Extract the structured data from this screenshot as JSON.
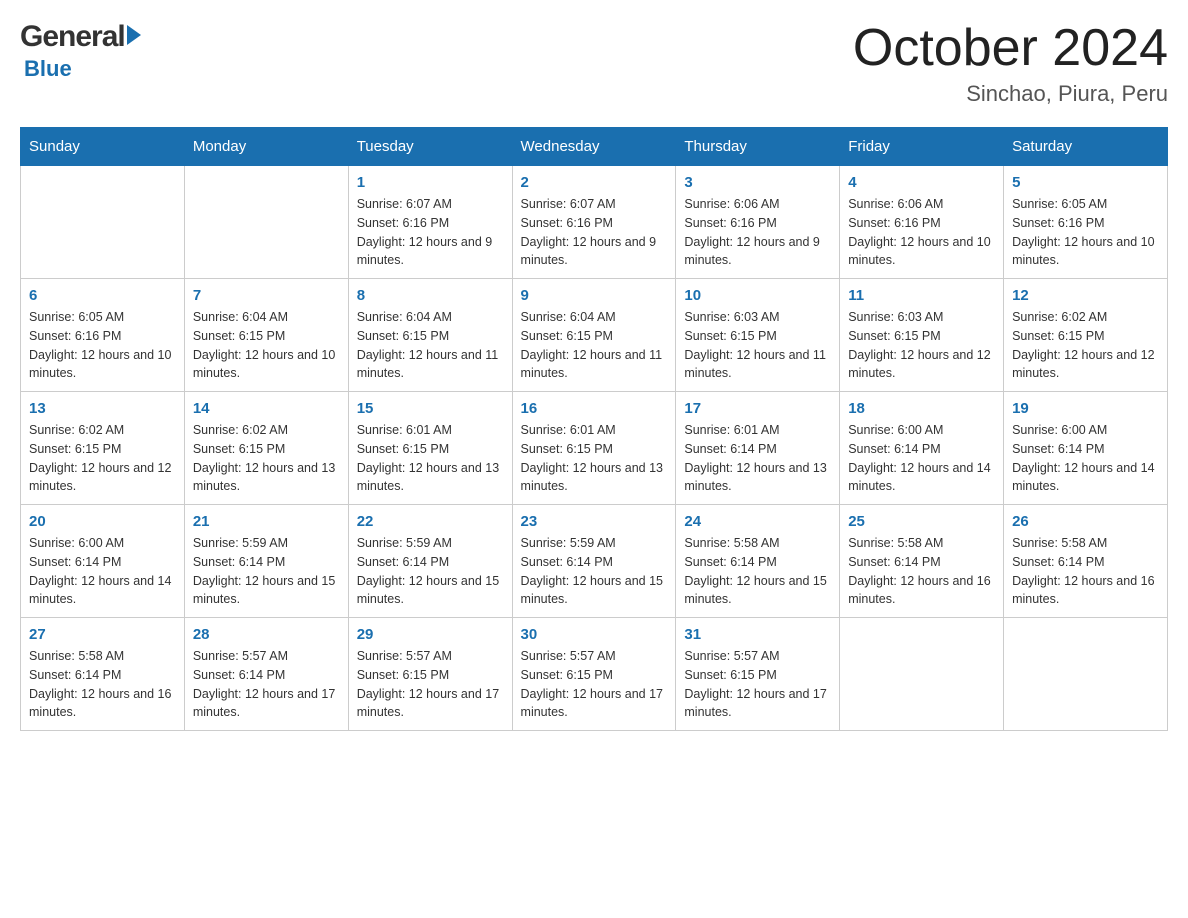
{
  "header": {
    "logo_general": "General",
    "logo_blue": "Blue",
    "month_title": "October 2024",
    "subtitle": "Sinchao, Piura, Peru"
  },
  "days_of_week": [
    "Sunday",
    "Monday",
    "Tuesday",
    "Wednesday",
    "Thursday",
    "Friday",
    "Saturday"
  ],
  "weeks": [
    [
      {
        "day": "",
        "sunrise": "",
        "sunset": "",
        "daylight": ""
      },
      {
        "day": "",
        "sunrise": "",
        "sunset": "",
        "daylight": ""
      },
      {
        "day": "1",
        "sunrise": "Sunrise: 6:07 AM",
        "sunset": "Sunset: 6:16 PM",
        "daylight": "Daylight: 12 hours and 9 minutes."
      },
      {
        "day": "2",
        "sunrise": "Sunrise: 6:07 AM",
        "sunset": "Sunset: 6:16 PM",
        "daylight": "Daylight: 12 hours and 9 minutes."
      },
      {
        "day": "3",
        "sunrise": "Sunrise: 6:06 AM",
        "sunset": "Sunset: 6:16 PM",
        "daylight": "Daylight: 12 hours and 9 minutes."
      },
      {
        "day": "4",
        "sunrise": "Sunrise: 6:06 AM",
        "sunset": "Sunset: 6:16 PM",
        "daylight": "Daylight: 12 hours and 10 minutes."
      },
      {
        "day": "5",
        "sunrise": "Sunrise: 6:05 AM",
        "sunset": "Sunset: 6:16 PM",
        "daylight": "Daylight: 12 hours and 10 minutes."
      }
    ],
    [
      {
        "day": "6",
        "sunrise": "Sunrise: 6:05 AM",
        "sunset": "Sunset: 6:16 PM",
        "daylight": "Daylight: 12 hours and 10 minutes."
      },
      {
        "day": "7",
        "sunrise": "Sunrise: 6:04 AM",
        "sunset": "Sunset: 6:15 PM",
        "daylight": "Daylight: 12 hours and 10 minutes."
      },
      {
        "day": "8",
        "sunrise": "Sunrise: 6:04 AM",
        "sunset": "Sunset: 6:15 PM",
        "daylight": "Daylight: 12 hours and 11 minutes."
      },
      {
        "day": "9",
        "sunrise": "Sunrise: 6:04 AM",
        "sunset": "Sunset: 6:15 PM",
        "daylight": "Daylight: 12 hours and 11 minutes."
      },
      {
        "day": "10",
        "sunrise": "Sunrise: 6:03 AM",
        "sunset": "Sunset: 6:15 PM",
        "daylight": "Daylight: 12 hours and 11 minutes."
      },
      {
        "day": "11",
        "sunrise": "Sunrise: 6:03 AM",
        "sunset": "Sunset: 6:15 PM",
        "daylight": "Daylight: 12 hours and 12 minutes."
      },
      {
        "day": "12",
        "sunrise": "Sunrise: 6:02 AM",
        "sunset": "Sunset: 6:15 PM",
        "daylight": "Daylight: 12 hours and 12 minutes."
      }
    ],
    [
      {
        "day": "13",
        "sunrise": "Sunrise: 6:02 AM",
        "sunset": "Sunset: 6:15 PM",
        "daylight": "Daylight: 12 hours and 12 minutes."
      },
      {
        "day": "14",
        "sunrise": "Sunrise: 6:02 AM",
        "sunset": "Sunset: 6:15 PM",
        "daylight": "Daylight: 12 hours and 13 minutes."
      },
      {
        "day": "15",
        "sunrise": "Sunrise: 6:01 AM",
        "sunset": "Sunset: 6:15 PM",
        "daylight": "Daylight: 12 hours and 13 minutes."
      },
      {
        "day": "16",
        "sunrise": "Sunrise: 6:01 AM",
        "sunset": "Sunset: 6:15 PM",
        "daylight": "Daylight: 12 hours and 13 minutes."
      },
      {
        "day": "17",
        "sunrise": "Sunrise: 6:01 AM",
        "sunset": "Sunset: 6:14 PM",
        "daylight": "Daylight: 12 hours and 13 minutes."
      },
      {
        "day": "18",
        "sunrise": "Sunrise: 6:00 AM",
        "sunset": "Sunset: 6:14 PM",
        "daylight": "Daylight: 12 hours and 14 minutes."
      },
      {
        "day": "19",
        "sunrise": "Sunrise: 6:00 AM",
        "sunset": "Sunset: 6:14 PM",
        "daylight": "Daylight: 12 hours and 14 minutes."
      }
    ],
    [
      {
        "day": "20",
        "sunrise": "Sunrise: 6:00 AM",
        "sunset": "Sunset: 6:14 PM",
        "daylight": "Daylight: 12 hours and 14 minutes."
      },
      {
        "day": "21",
        "sunrise": "Sunrise: 5:59 AM",
        "sunset": "Sunset: 6:14 PM",
        "daylight": "Daylight: 12 hours and 15 minutes."
      },
      {
        "day": "22",
        "sunrise": "Sunrise: 5:59 AM",
        "sunset": "Sunset: 6:14 PM",
        "daylight": "Daylight: 12 hours and 15 minutes."
      },
      {
        "day": "23",
        "sunrise": "Sunrise: 5:59 AM",
        "sunset": "Sunset: 6:14 PM",
        "daylight": "Daylight: 12 hours and 15 minutes."
      },
      {
        "day": "24",
        "sunrise": "Sunrise: 5:58 AM",
        "sunset": "Sunset: 6:14 PM",
        "daylight": "Daylight: 12 hours and 15 minutes."
      },
      {
        "day": "25",
        "sunrise": "Sunrise: 5:58 AM",
        "sunset": "Sunset: 6:14 PM",
        "daylight": "Daylight: 12 hours and 16 minutes."
      },
      {
        "day": "26",
        "sunrise": "Sunrise: 5:58 AM",
        "sunset": "Sunset: 6:14 PM",
        "daylight": "Daylight: 12 hours and 16 minutes."
      }
    ],
    [
      {
        "day": "27",
        "sunrise": "Sunrise: 5:58 AM",
        "sunset": "Sunset: 6:14 PM",
        "daylight": "Daylight: 12 hours and 16 minutes."
      },
      {
        "day": "28",
        "sunrise": "Sunrise: 5:57 AM",
        "sunset": "Sunset: 6:14 PM",
        "daylight": "Daylight: 12 hours and 17 minutes."
      },
      {
        "day": "29",
        "sunrise": "Sunrise: 5:57 AM",
        "sunset": "Sunset: 6:15 PM",
        "daylight": "Daylight: 12 hours and 17 minutes."
      },
      {
        "day": "30",
        "sunrise": "Sunrise: 5:57 AM",
        "sunset": "Sunset: 6:15 PM",
        "daylight": "Daylight: 12 hours and 17 minutes."
      },
      {
        "day": "31",
        "sunrise": "Sunrise: 5:57 AM",
        "sunset": "Sunset: 6:15 PM",
        "daylight": "Daylight: 12 hours and 17 minutes."
      },
      {
        "day": "",
        "sunrise": "",
        "sunset": "",
        "daylight": ""
      },
      {
        "day": "",
        "sunrise": "",
        "sunset": "",
        "daylight": ""
      }
    ]
  ]
}
